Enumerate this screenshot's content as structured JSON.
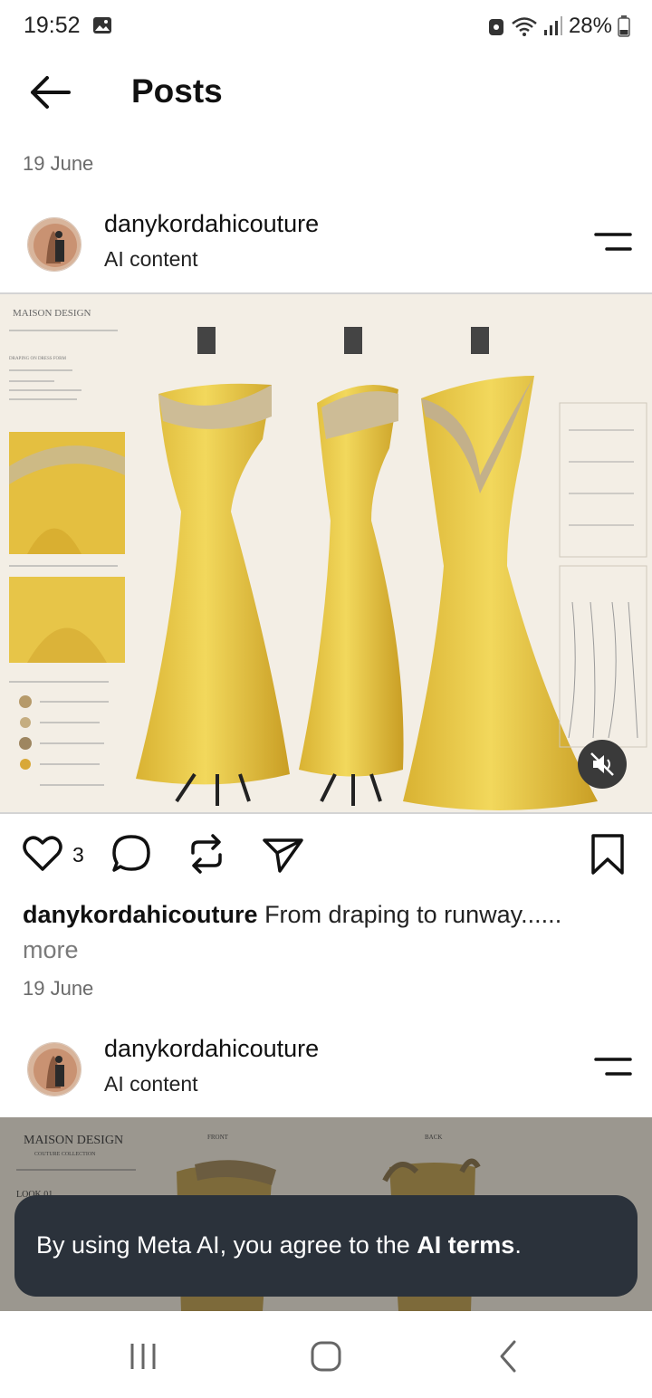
{
  "status_bar": {
    "time": "19:52",
    "battery": "28%"
  },
  "header": {
    "title": "Posts"
  },
  "posts": [
    {
      "date": "19 June",
      "author": "danykordahicouture",
      "ai_label": "AI content",
      "image_texts": [
        "MAISON DESIGN",
        "DRAPING ON DRESS FORM"
      ],
      "likes": "3",
      "caption": "From draping to runway......",
      "more": "more",
      "posted": "19 June"
    },
    {
      "author": "danykordahicouture",
      "ai_label": "AI content",
      "image_texts": [
        "MAISON DESIGN",
        "COUTURE COLLECTION",
        "FRONT",
        "BACK",
        "LOOK 01"
      ]
    }
  ],
  "toast": {
    "prefix": "By using Meta AI, you agree to the ",
    "link": "AI terms",
    "suffix": "."
  },
  "colors": {
    "gown": "#e9cc4a",
    "toast_bg": "#2b323b",
    "image_bg": "#f1ece3",
    "muted": "#6b6b6b"
  },
  "icons": [
    "gallery-icon",
    "wifi-icon",
    "signal-icon",
    "battery-icon",
    "back-arrow-icon",
    "menu-icon",
    "heart-icon",
    "comment-icon",
    "repost-icon",
    "share-icon",
    "bookmark-icon",
    "mute-icon",
    "recents-icon",
    "home-icon",
    "back-nav-icon"
  ]
}
